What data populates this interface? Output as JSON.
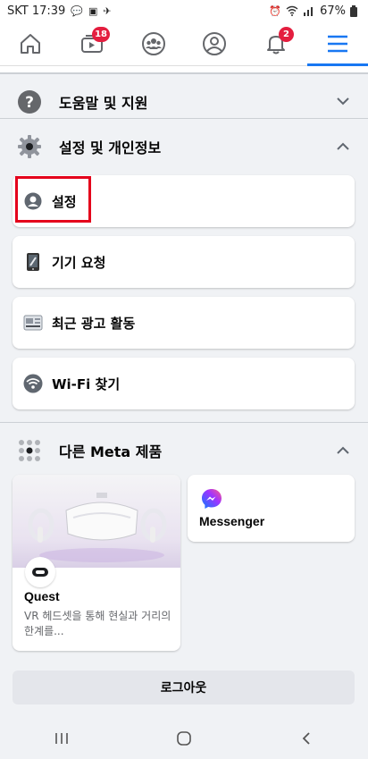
{
  "status_bar": {
    "carrier_time": "SKT 17:39",
    "battery": "67%"
  },
  "nav": {
    "video_badge": "18",
    "notifications_badge": "2"
  },
  "sections": {
    "help": "도움말 및 지원",
    "settings_privacy": "설정 및 개인정보",
    "meta_products": "다른 Meta 제품"
  },
  "settings_items": [
    {
      "label": "설정",
      "icon": "account-settings-icon"
    },
    {
      "label": "기기 요청",
      "icon": "phone-icon"
    },
    {
      "label": "최근 광고 활동",
      "icon": "ad-activity-icon"
    },
    {
      "label": "Wi-Fi 찾기",
      "icon": "wifi-icon"
    }
  ],
  "products": {
    "quest_title": "Quest",
    "quest_desc": "VR 헤드셋을 통해 현실과 거리의 한계를...",
    "messenger_title": "Messenger"
  },
  "logout_label": "로그아웃",
  "colors": {
    "accent": "#1877f2",
    "badge": "#e41e3f",
    "highlight": "#e4001b"
  }
}
